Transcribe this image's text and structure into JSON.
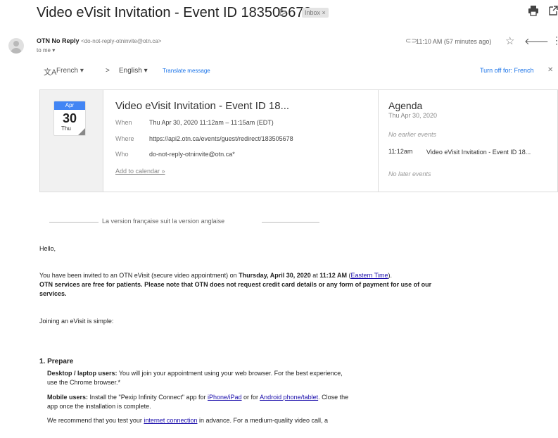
{
  "header": {
    "subject": "Video eVisit Invitation - Event ID 183505678",
    "inbox_label": "Inbox ×"
  },
  "sender": {
    "name": "OTN No Reply",
    "email": "<do-not-reply-otninvite@otn.ca>",
    "to": "to me ▾",
    "time": "11:10 AM (57 minutes ago)"
  },
  "translate": {
    "from": "French ▾",
    "arrow": ">",
    "to": "English ▾",
    "link": "Translate message",
    "off": "Turn off for: French"
  },
  "invite": {
    "cal_month": "Apr",
    "cal_day": "30",
    "cal_dow": "Thu",
    "title": "Video eVisit Invitation - Event ID 18...",
    "when_label": "When",
    "when": "Thu Apr 30, 2020 11:12am – 11:15am (EDT)",
    "where_label": "Where",
    "where": "https://api2.otn.ca/events/guest/redirect/183505678",
    "who_label": "Who",
    "who": "do-not-reply-otninvite@otn.ca*",
    "add_calendar": "Add to calendar »"
  },
  "agenda": {
    "title": "Agenda",
    "date": "Thu Apr 30, 2020",
    "earlier": "No earlier events",
    "event_time": "11:12am",
    "event_title": "Video eVisit Invitation - Event ID 18...",
    "later": "No later events"
  },
  "body": {
    "french_note": "La version française suit la version anglaise",
    "hello": "Hello,",
    "invited_1": "You have been invited to an OTN eVisit (secure video appointment) on ",
    "invited_date": "Thursday, April 30, 2020",
    "invited_at": " at ",
    "invited_time": "11:12 AM",
    "invited_space": " (",
    "eastern_link": "Eastern Time",
    "invited_end": ").",
    "free_notice_1": "OTN services are free for patients. Please note that OTN does not request credit card details or any form of payment for use of our",
    "free_notice_2": "services.",
    "simple": "Joining an eVisit is simple:",
    "prepare_heading": "1. Prepare",
    "desktop_label": "Desktop / laptop users:",
    "desktop_text_1": " You will join your appointment using your web browser. For the best experience,",
    "desktop_text_2": "use the Chrome browser.*",
    "mobile_label": "Mobile users:",
    "mobile_text_1": " Install the \"Pexip Infinity Connect\" app for ",
    "iphone_link": "iPhone/iPad",
    "mobile_or": " or for ",
    "android_link": "Android phone/tablet",
    "mobile_text_2": ". Close the",
    "mobile_text_3": "app once the installation is complete.",
    "test_1": "We recommend that you test your ",
    "internet_link": "internet connection",
    "test_2": " in advance. For a medium-quality video call, a"
  }
}
